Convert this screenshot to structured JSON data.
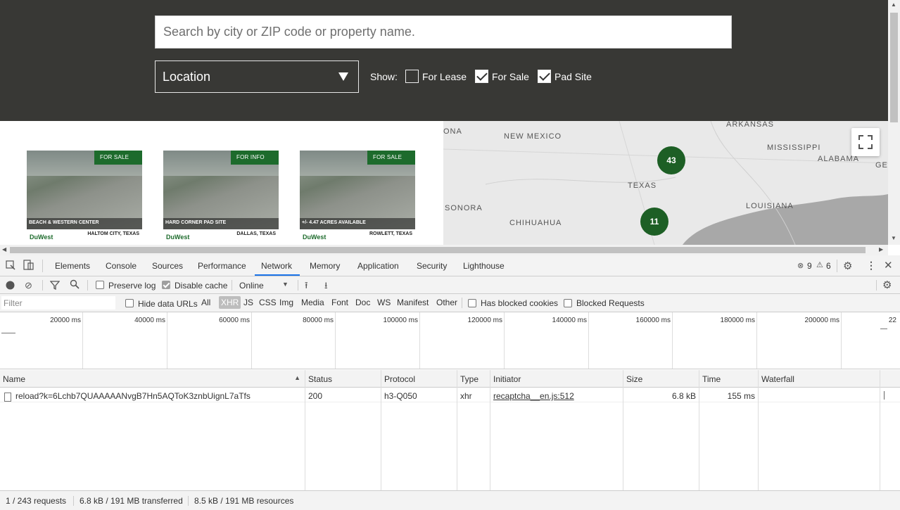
{
  "site": {
    "search_placeholder": "Search by city or ZIP code or property name.",
    "location_label": "Location",
    "show_label": "Show:",
    "filters": [
      {
        "label": "For Lease",
        "checked": false
      },
      {
        "label": "For Sale",
        "checked": true
      },
      {
        "label": "Pad Site",
        "checked": true
      }
    ],
    "cards": [
      {
        "badge": "FOR SALE",
        "caption": "BEACH & WESTERN CENTER",
        "footer": "DuWest",
        "sub": "HALTOM CITY, TEXAS"
      },
      {
        "badge": "FOR INFO",
        "caption": "HARD CORNER PAD SITE",
        "footer": "DuWest",
        "sub": "DALLAS, TEXAS"
      },
      {
        "badge": "FOR SALE",
        "caption": "+/- 4.47 ACRES AVAILABLE",
        "footer": "DuWest",
        "sub": "ROWLETT, TEXAS"
      }
    ],
    "map": {
      "labels": [
        "ONA",
        "NEW MEXICO",
        "ARKANSAS",
        "MISSISSIPPI",
        "ALABAMA",
        "GE",
        "TEXAS",
        "LOUISIANA",
        "SONORA",
        "CHIHUAHUA"
      ],
      "clusters": [
        "43",
        "11"
      ],
      "cluster_color": "#1d5f25"
    }
  },
  "devtools": {
    "tabs": [
      "Elements",
      "Console",
      "Sources",
      "Performance",
      "Network",
      "Memory",
      "Application",
      "Security",
      "Lighthouse"
    ],
    "active_tab": "Network",
    "errors": "9",
    "warnings": "6",
    "preserve_log": "Preserve log",
    "disable_cache": "Disable cache",
    "throttle": "Online",
    "filter_placeholder": "Filter",
    "hide_data_urls": "Hide data URLs",
    "types": [
      "All",
      "XHR",
      "JS",
      "CSS",
      "Img",
      "Media",
      "Font",
      "Doc",
      "WS",
      "Manifest",
      "Other"
    ],
    "selected_type": "XHR",
    "has_blocked_cookies": "Has blocked cookies",
    "blocked_requests": "Blocked Requests",
    "timeline_ticks": [
      "20000 ms",
      "40000 ms",
      "60000 ms",
      "80000 ms",
      "100000 ms",
      "120000 ms",
      "140000 ms",
      "160000 ms",
      "180000 ms",
      "200000 ms",
      "22"
    ],
    "columns": [
      "Name",
      "Status",
      "Protocol",
      "Type",
      "Initiator",
      "Size",
      "Time",
      "Waterfall"
    ],
    "rows": [
      {
        "name": "reload?k=6Lchb7QUAAAAANvgB7Hn5AQToK3znbUignL7aTfs",
        "status": "200",
        "protocol": "h3-Q050",
        "type": "xhr",
        "initiator": "recaptcha__en.js:512",
        "size": "6.8 kB",
        "time": "155 ms"
      }
    ],
    "status": {
      "requests": "1 / 243 requests",
      "transferred": "6.8 kB / 191 MB transferred",
      "resources": "8.5 kB / 191 MB resources"
    }
  }
}
